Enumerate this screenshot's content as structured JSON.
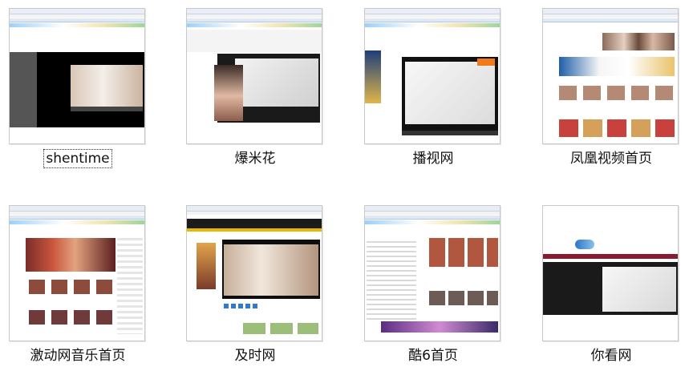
{
  "tiles": [
    {
      "label": "shentime"
    },
    {
      "label": "爆米花"
    },
    {
      "label": "播视网"
    },
    {
      "label": "凤凰视频首页"
    },
    {
      "label": "激动网音乐首页"
    },
    {
      "label": "及时网"
    },
    {
      "label": "酷6首页"
    },
    {
      "label": "你看网"
    }
  ],
  "colors": {
    "border": "#c9c9c9",
    "label_text": "#111111",
    "video_black": "#000000"
  }
}
